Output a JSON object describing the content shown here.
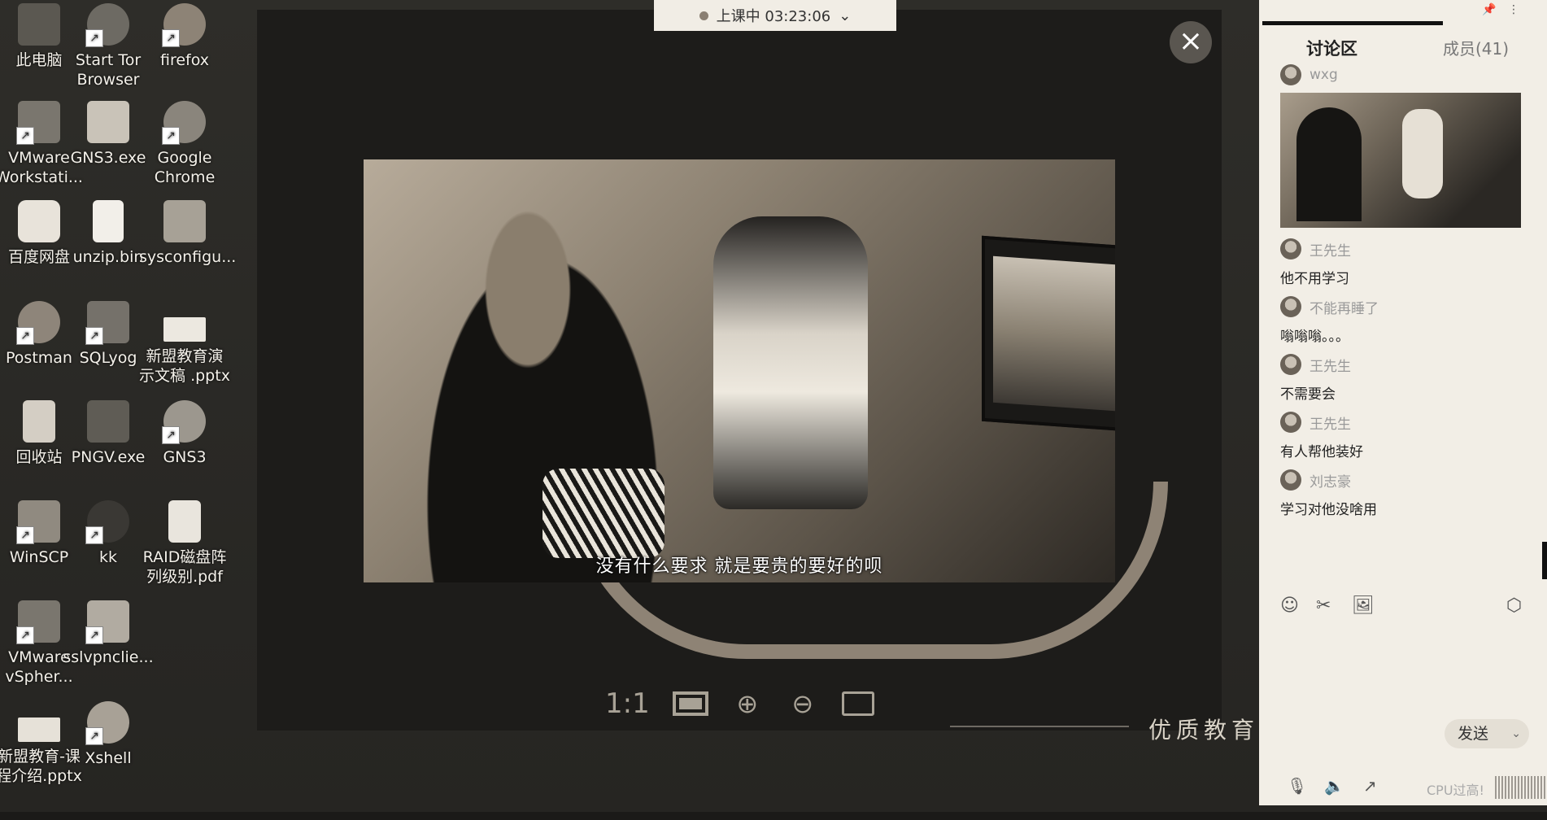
{
  "status_bar": {
    "label": "上课中 03:23:06",
    "dropdown": "⌄"
  },
  "desktop_icons": [
    {
      "label": "此电脑",
      "glyph": "🖥"
    },
    {
      "label": "Start Tor Browser",
      "glyph": "◎"
    },
    {
      "label": "firefox",
      "glyph": "🦊"
    },
    {
      "label": "VMware Workstati...",
      "glyph": "▣"
    },
    {
      "label": "GNS3.exe",
      "glyph": "⚙"
    },
    {
      "label": "Google Chrome",
      "glyph": "◉"
    },
    {
      "label": "百度网盘",
      "glyph": "☁"
    },
    {
      "label": "unzip.bin",
      "glyph": "📄"
    },
    {
      "label": "sysconfigu...",
      "glyph": "✎"
    },
    {
      "label": "Postman",
      "glyph": "✈"
    },
    {
      "label": "SQLyog",
      "glyph": "🐬"
    },
    {
      "label": "新盟教育演示文稿 .pptx",
      "glyph": "▭"
    },
    {
      "label": "回收站",
      "glyph": "♻"
    },
    {
      "label": "PNGV.exe",
      "glyph": "▦"
    },
    {
      "label": "GNS3",
      "glyph": "⚙"
    },
    {
      "label": "WinSCP",
      "glyph": "🔒"
    },
    {
      "label": "kk",
      "glyph": "☻"
    },
    {
      "label": "RAID磁盘阵列级别.pdf",
      "glyph": "PDF"
    },
    {
      "label": "VMware vSpher...",
      "glyph": "▣"
    },
    {
      "label": "sslvpnclie...",
      "glyph": "🖧"
    },
    {
      "label": "新盟教育-课程介绍.pptx",
      "glyph": "▭"
    },
    {
      "label": "Xshell",
      "glyph": "🐚"
    }
  ],
  "viewer": {
    "subtitle": "没有什么要求 就是要贵的要好的呗",
    "close_icon": "×",
    "tools": {
      "ratio": "1:1",
      "zoom_in": "⊕",
      "zoom_out": "⊖"
    }
  },
  "watermark": "优质教育",
  "chat": {
    "tab_discuss": "讨论区",
    "tab_members": "成员(41)",
    "pin": "📌",
    "more": "⋮",
    "messages": [
      {
        "user": "wxg",
        "text": "",
        "has_image": true
      },
      {
        "user": "王先生",
        "text": "他不用学习"
      },
      {
        "user": "不能再睡了",
        "text": "嗡嗡嗡。。。"
      },
      {
        "user": "王先生",
        "text": "不需要会"
      },
      {
        "user": "王先生",
        "text": "有人帮他装好"
      },
      {
        "user": "刘志豪",
        "text": "学习对他没啥用"
      }
    ],
    "tools": {
      "emoji": "☺",
      "scissors": "✂",
      "image": "🖼",
      "settings": "⬡"
    },
    "send_label": "发送",
    "send_caret": "⌄",
    "bottom": {
      "mic": "🎙",
      "speaker": "🔈",
      "share": "↗",
      "cpu_label": "CPU过高!"
    }
  }
}
